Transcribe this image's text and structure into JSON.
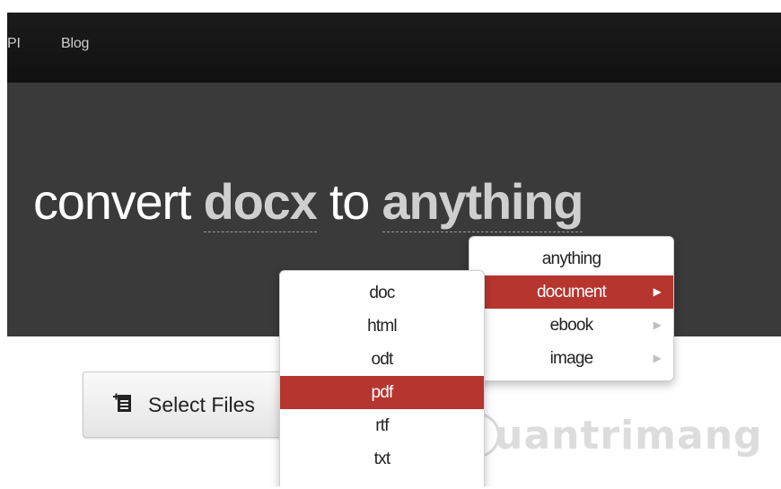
{
  "nav": {
    "api_label": "PI",
    "blog_label": "Blog"
  },
  "hero": {
    "prefix": "convert",
    "format": "docx",
    "middle": "to",
    "target": "anything"
  },
  "upload": {
    "button_label": "Select Files",
    "icon": "file-add-icon"
  },
  "target_menu": {
    "items": [
      {
        "label": "anything",
        "has_submenu": false,
        "active": false
      },
      {
        "label": "document",
        "has_submenu": true,
        "active": true
      },
      {
        "label": "ebook",
        "has_submenu": true,
        "active": false
      },
      {
        "label": "image",
        "has_submenu": true,
        "active": false
      }
    ]
  },
  "document_submenu": {
    "items": [
      {
        "label": "doc",
        "active": false
      },
      {
        "label": "html",
        "active": false
      },
      {
        "label": "odt",
        "active": false
      },
      {
        "label": "pdf",
        "active": true
      },
      {
        "label": "rtf",
        "active": false
      },
      {
        "label": "txt",
        "active": false
      }
    ]
  },
  "watermark": {
    "text": "uantrimang",
    "icon": "lightbulb-logo"
  },
  "colors": {
    "accent": "#b6352f",
    "topbar": "#151515",
    "hero": "#3a3a3a"
  }
}
